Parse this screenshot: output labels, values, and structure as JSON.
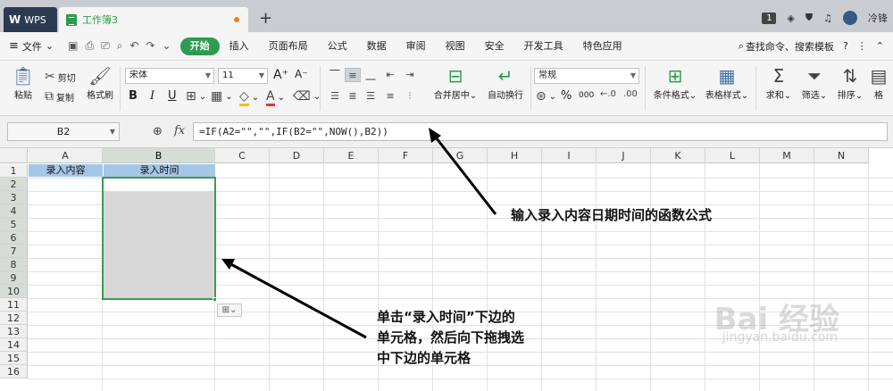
{
  "titlebar": {
    "tabs": [
      {
        "label": "WPS",
        "logo": "W"
      },
      {
        "label": "工作簿3"
      }
    ],
    "new_tab": "+",
    "badge": "1",
    "user": "冷锋"
  },
  "menubar": {
    "file_menu": "文件",
    "items": [
      "开始",
      "插入",
      "页面布局",
      "公式",
      "数据",
      "审阅",
      "视图",
      "安全",
      "开发工具",
      "特色应用"
    ],
    "search": "查找命令、搜索模板",
    "help": "?"
  },
  "ribbon": {
    "paste": "粘贴",
    "cut": "剪切",
    "copy": "复制",
    "format_painter": "格式刷",
    "font_name": "宋体",
    "font_size": "11",
    "bold": "B",
    "italic": "I",
    "underline": "U",
    "merge_center": "合并居中",
    "wrap_text": "自动换行",
    "number_format": "常规",
    "percent": "%",
    "thousands": "000",
    "conditional_format": "条件格式",
    "table_style": "表格样式",
    "sum": "求和",
    "filter": "筛选",
    "sort": "排序",
    "format": "格"
  },
  "formula_bar": {
    "name_box": "B2",
    "fx": "fx",
    "formula": "=IF(A2=\"\",\"\",IF(B2=\"\",NOW(),B2))"
  },
  "grid": {
    "columns": [
      "A",
      "B",
      "C",
      "D",
      "E",
      "F",
      "G",
      "H",
      "I",
      "J",
      "K",
      "L",
      "M",
      "N"
    ],
    "rows": [
      "1",
      "2",
      "3",
      "4",
      "5",
      "6",
      "7",
      "8",
      "9",
      "10",
      "11",
      "12",
      "13",
      "14",
      "15",
      "16"
    ],
    "header_cells": {
      "A1": "录入内容",
      "B1": "录入时间"
    },
    "selection": "B2:B10",
    "header_color": "#a6c6e6",
    "selection_color": "#3f9a4f"
  },
  "annotations": {
    "formula_note": "输入录入内容日期时间的函数公式",
    "select_note_line1": "单击“录入时间”下边的",
    "select_note_line2": "单元格，然后向下拖拽选",
    "select_note_line3": "中下边的单元格"
  },
  "watermark": {
    "brand": "Bai 经验",
    "url": "jingyan.baidu.com"
  }
}
